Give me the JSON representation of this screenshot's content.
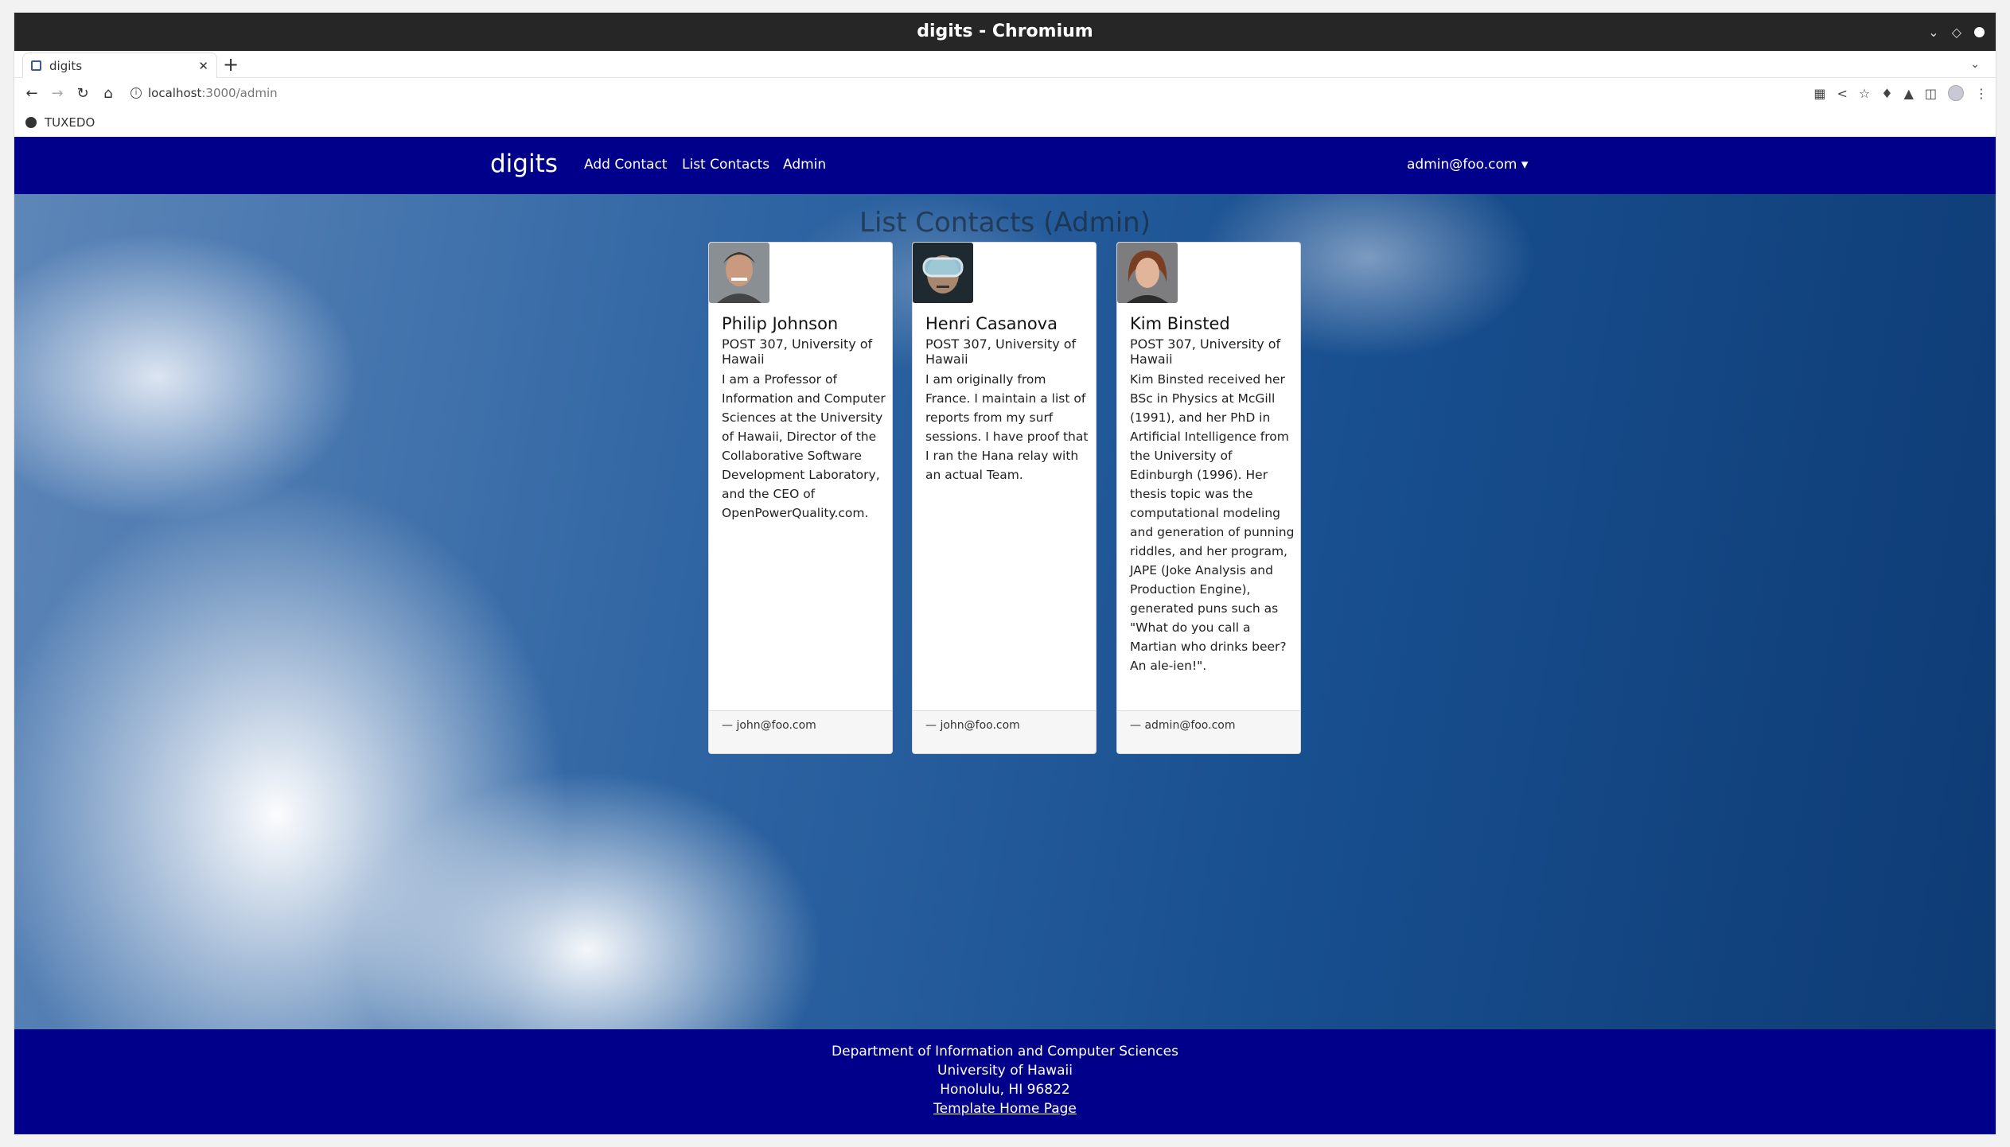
{
  "browser": {
    "window_title": "digits - Chromium",
    "tab_title": "digits",
    "new_tab_label": "+",
    "url_host": "localhost",
    "url_path": ":3000/admin",
    "bookmark": "TUXEDO"
  },
  "app": {
    "brand": "digits",
    "nav": [
      "Add Contact",
      "List Contacts",
      "Admin"
    ],
    "user_menu": "admin@foo.com ▾"
  },
  "page": {
    "title": "List Contacts (Admin)"
  },
  "contacts": [
    {
      "name": "Philip Johnson",
      "address": "POST 307, University of Hawaii",
      "description": "I am a Professor of Information and Computer Sciences at the University of Hawaii, Director of the Collaborative Software Development Laboratory, and the CEO of OpenPowerQuality.com.",
      "owner": "— john@foo.com"
    },
    {
      "name": "Henri Casanova",
      "address": "POST 307, University of Hawaii",
      "description": "I am originally from France. I maintain a list of reports from my surf sessions. I have proof that I ran the Hana relay with an actual Team.",
      "owner": "— john@foo.com"
    },
    {
      "name": "Kim Binsted",
      "address": "POST 307, University of Hawaii",
      "description": "Kim Binsted received her BSc in Physics at McGill (1991), and her PhD in Artificial Intelligence from the University of Edinburgh (1996). Her thesis topic was the computational modeling and generation of punning riddles, and her program, JAPE (Joke Analysis and Production Engine), generated puns such as \"What do you call a Martian who drinks beer? An ale-ien!\".",
      "owner": "— admin@foo.com"
    }
  ],
  "footer": {
    "line1": "Department of Information and Computer Sciences",
    "line2": "University of Hawaii",
    "line3": "Honolulu, HI 96822",
    "link": "Template Home Page"
  },
  "colors": {
    "navbar": "#00008b",
    "titlebar": "#262626"
  }
}
